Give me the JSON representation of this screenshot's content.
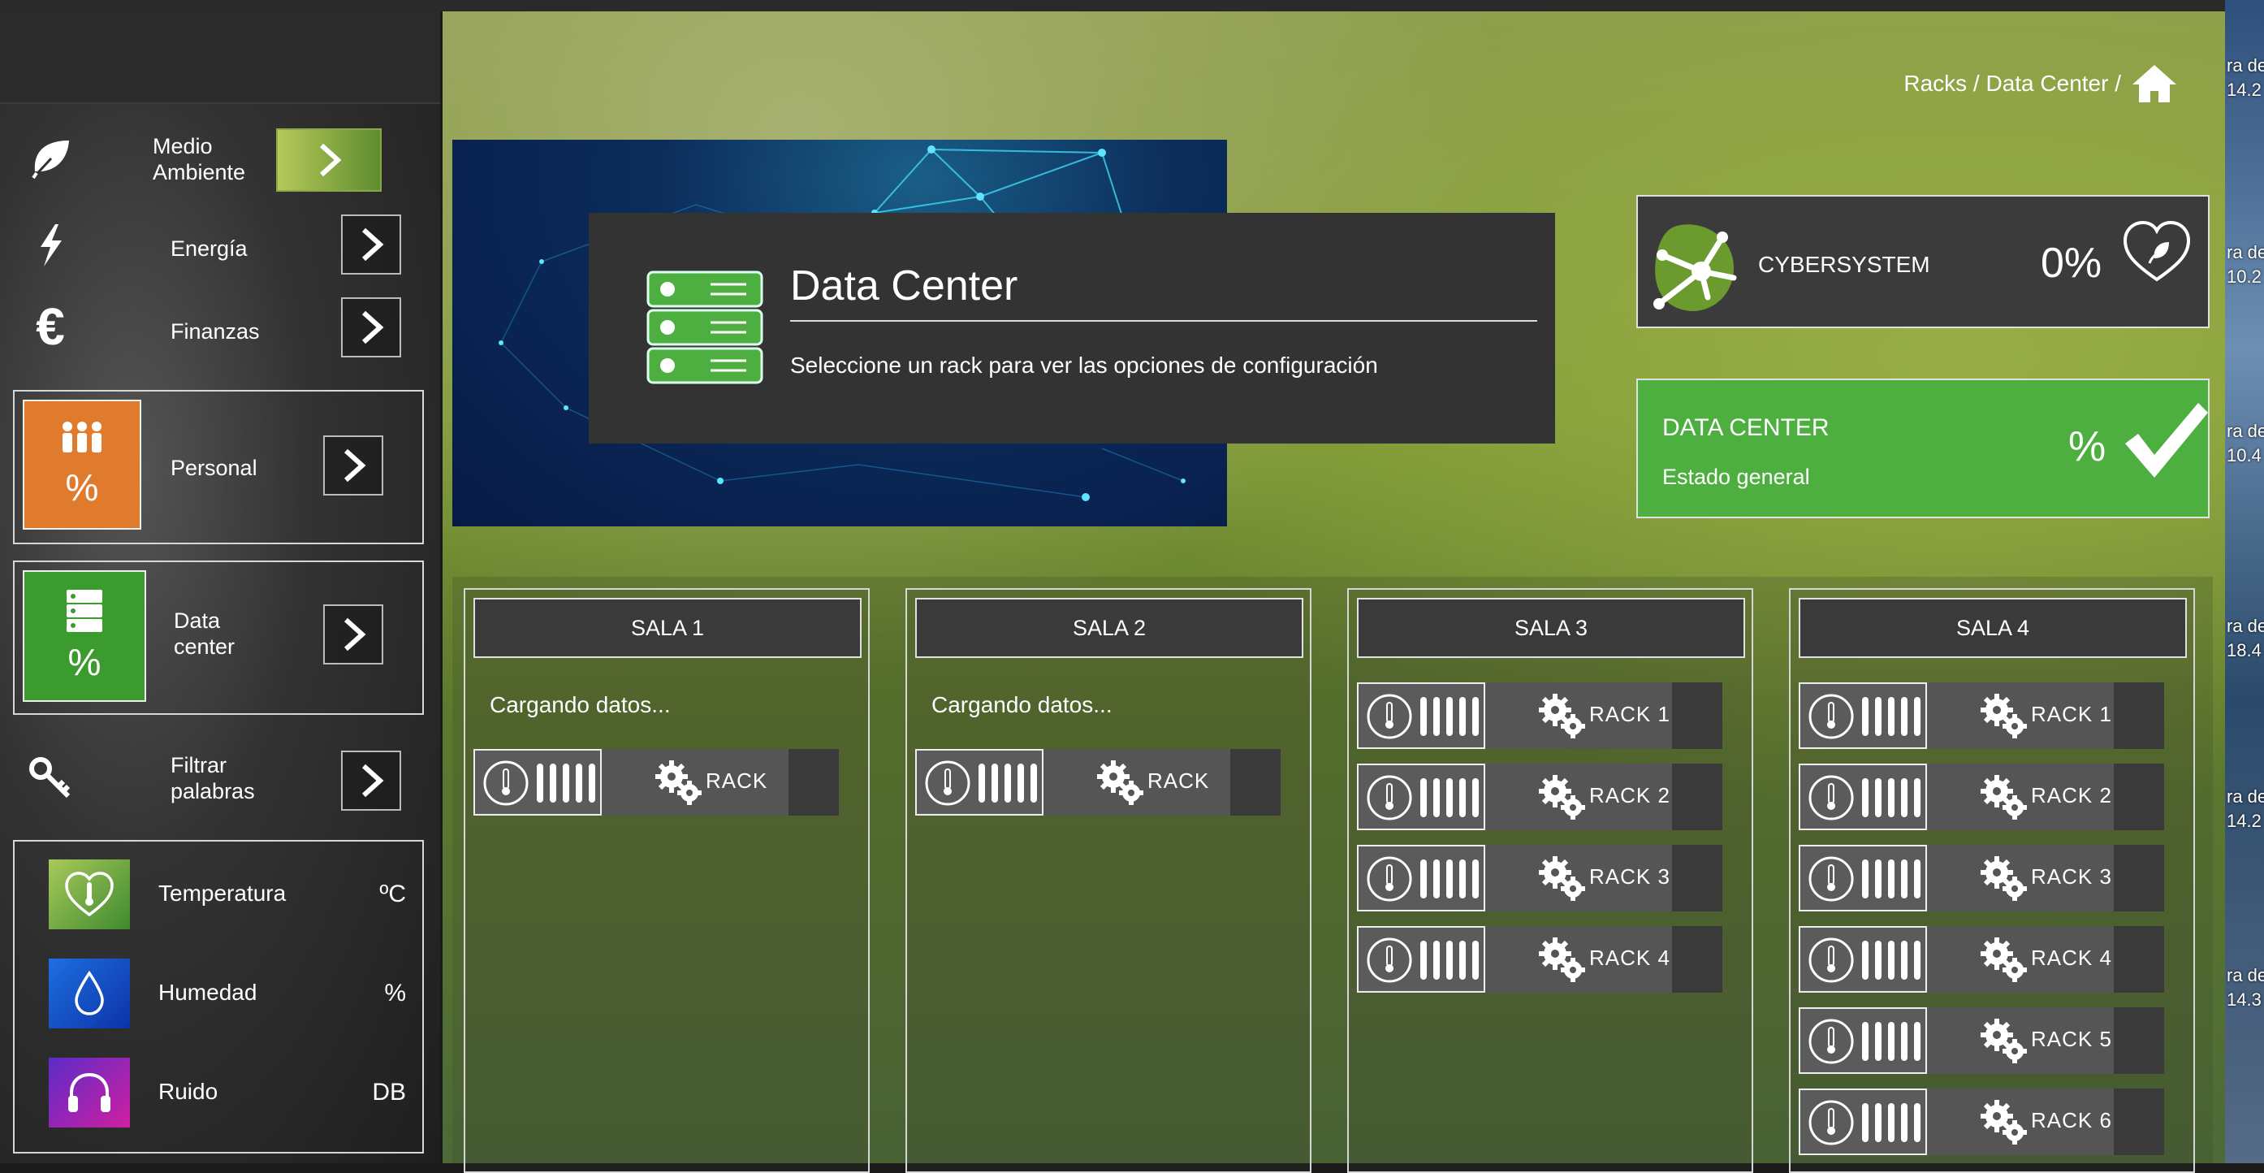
{
  "sidebar": {
    "items": [
      {
        "label_line1": "Medio",
        "label_line2": "Ambiente",
        "icon": "leaf-icon"
      },
      {
        "label": "Energía",
        "icon": "lightning-icon"
      },
      {
        "label": "Finanzas",
        "icon": "euro-icon"
      },
      {
        "label": "Personal",
        "icon": "people-icon",
        "value": "%"
      },
      {
        "label_line1": "Data",
        "label_line2": "center",
        "icon": "server-icon",
        "value": "%"
      },
      {
        "label_line1": "Filtrar",
        "label_line2": "palabras",
        "icon": "key-icon"
      }
    ],
    "metrics": [
      {
        "label": "Temperatura",
        "unit": "ºC",
        "icon": "heart-thermometer-icon"
      },
      {
        "label": "Humedad",
        "unit": "%",
        "icon": "droplet-icon"
      },
      {
        "label": "Ruido",
        "unit": "DB",
        "icon": "headphones-icon"
      }
    ]
  },
  "breadcrumb": {
    "text": "Racks / Data Center /",
    "icon": "home-icon"
  },
  "info": {
    "title": "Data Center",
    "description": "Seleccione un rack para ver las opciones de configuración"
  },
  "cybersystem": {
    "label": "CYBERSYSTEM",
    "value": "0%"
  },
  "datacenter_card": {
    "title": "DATA CENTER",
    "subtitle": "Estado general",
    "value": "%"
  },
  "salas": [
    {
      "title": "SALA 1",
      "loading": "Cargando datos...",
      "racks": [
        "RACK"
      ]
    },
    {
      "title": "SALA 2",
      "loading": "Cargando datos...",
      "racks": [
        "RACK"
      ]
    },
    {
      "title": "SALA 3",
      "racks": [
        "RACK 1",
        "RACK 2",
        "RACK 3",
        "RACK 4"
      ]
    },
    {
      "title": "SALA 4",
      "racks": [
        "RACK 1",
        "RACK 2",
        "RACK 3",
        "RACK 4",
        "RACK 5",
        "RACK 6"
      ]
    }
  ],
  "desktop_items": [
    "ra de",
    "14.2",
    "ra de",
    "10.2",
    "ra de",
    "10.4",
    "ra de",
    "18.4",
    "ra de",
    "14.2",
    "ra de",
    "14.3"
  ],
  "colors": {
    "accent_green": "#4caf3f",
    "orange": "#e07b2e",
    "dark_panel": "#333333"
  }
}
